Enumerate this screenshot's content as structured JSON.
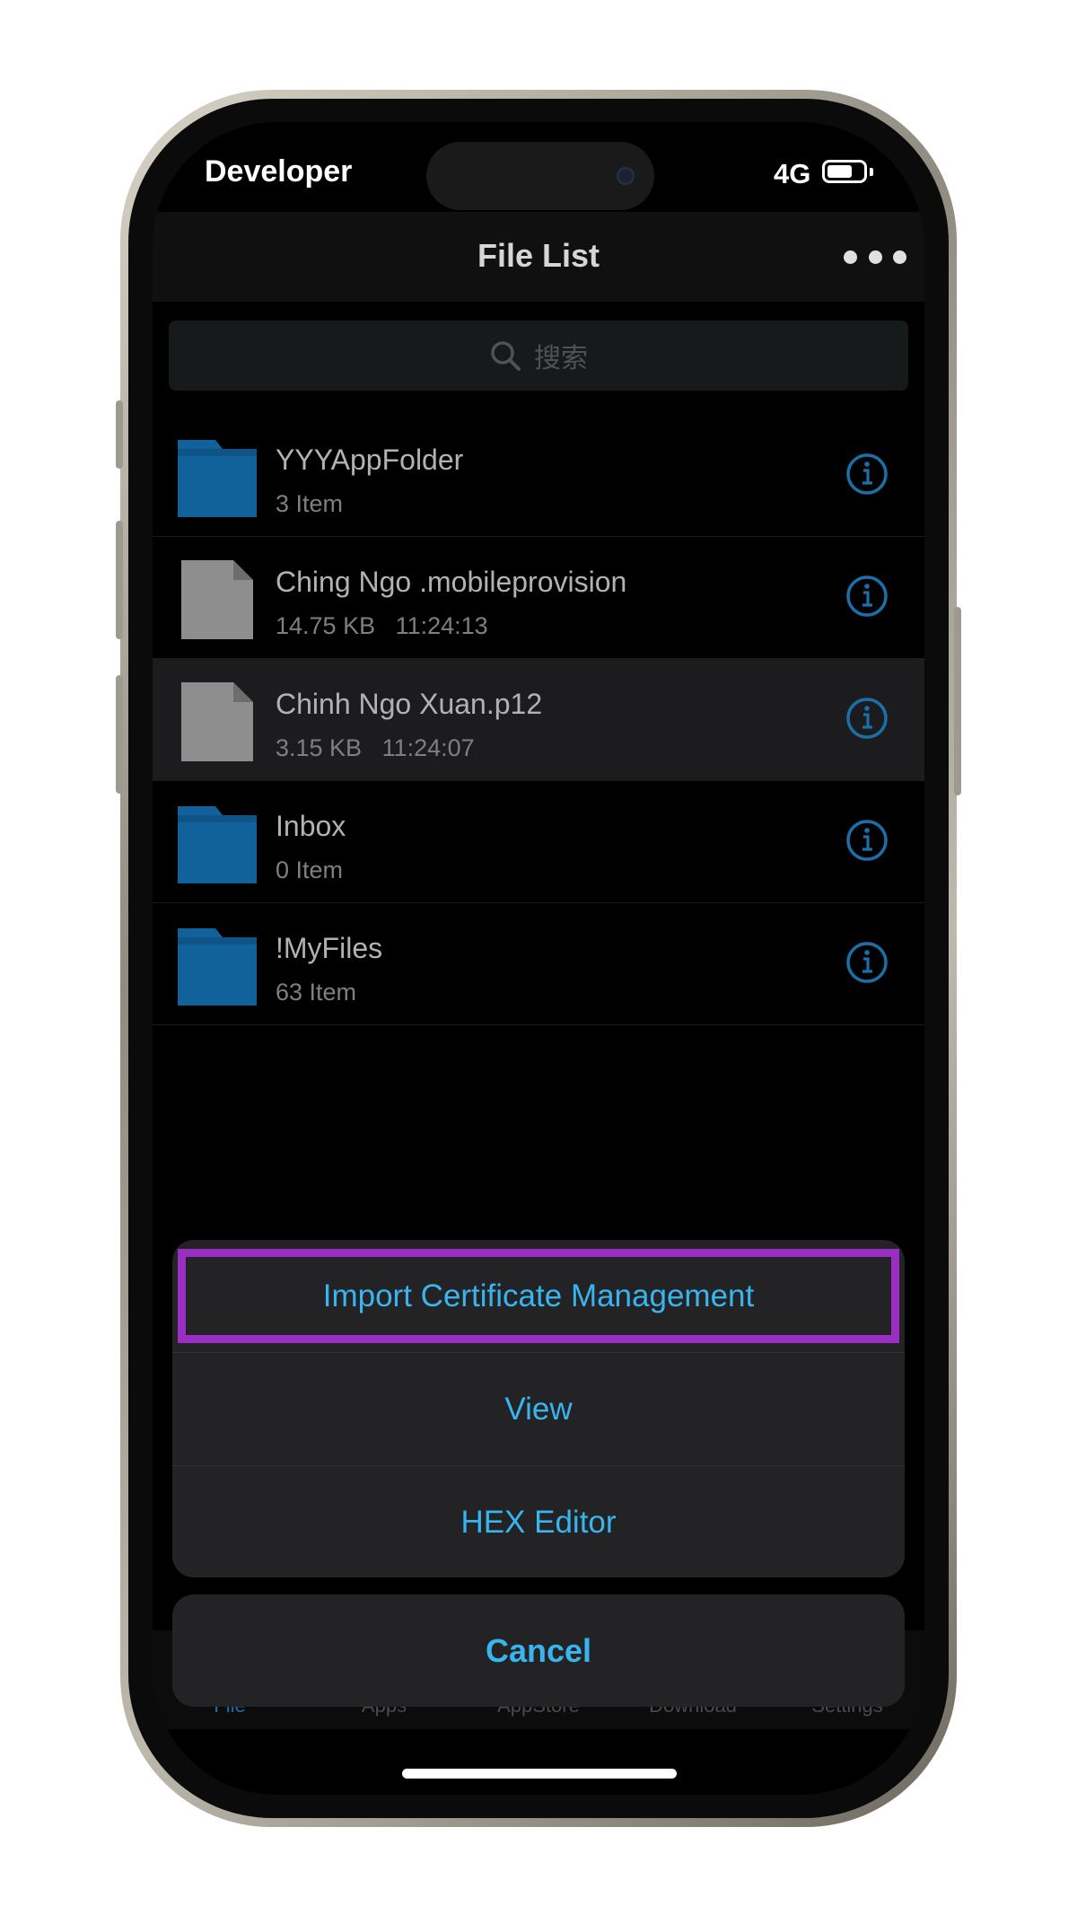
{
  "status_bar": {
    "carrier": "Developer",
    "network": "4G"
  },
  "nav": {
    "title": "File List"
  },
  "search": {
    "placeholder": "搜索"
  },
  "files": [
    {
      "name": "YYYAppFolder",
      "meta": "3 Item",
      "kind": "folder"
    },
    {
      "name": "Ching Ngo .mobileprovision",
      "meta": "14.75 KB   11:24:13",
      "kind": "file"
    },
    {
      "name": "Chinh Ngo Xuan.p12",
      "meta": "3.15 KB   11:24:07",
      "kind": "file",
      "selected": true
    },
    {
      "name": "Inbox",
      "meta": "0 Item",
      "kind": "folder"
    },
    {
      "name": "!MyFiles",
      "meta": "63 Item",
      "kind": "folder"
    }
  ],
  "action_sheet": {
    "items": [
      "Import Certificate Management",
      "View",
      "HEX Editor"
    ],
    "cancel": "Cancel"
  },
  "tabs": [
    {
      "label": "File",
      "active": true
    },
    {
      "label": "Apps"
    },
    {
      "label": "AppStore"
    },
    {
      "label": "Download"
    },
    {
      "label": "Settings"
    }
  ],
  "colors": {
    "accent": "#38b4ee",
    "folder": "#11619a",
    "highlight": "#9a2ec4"
  }
}
